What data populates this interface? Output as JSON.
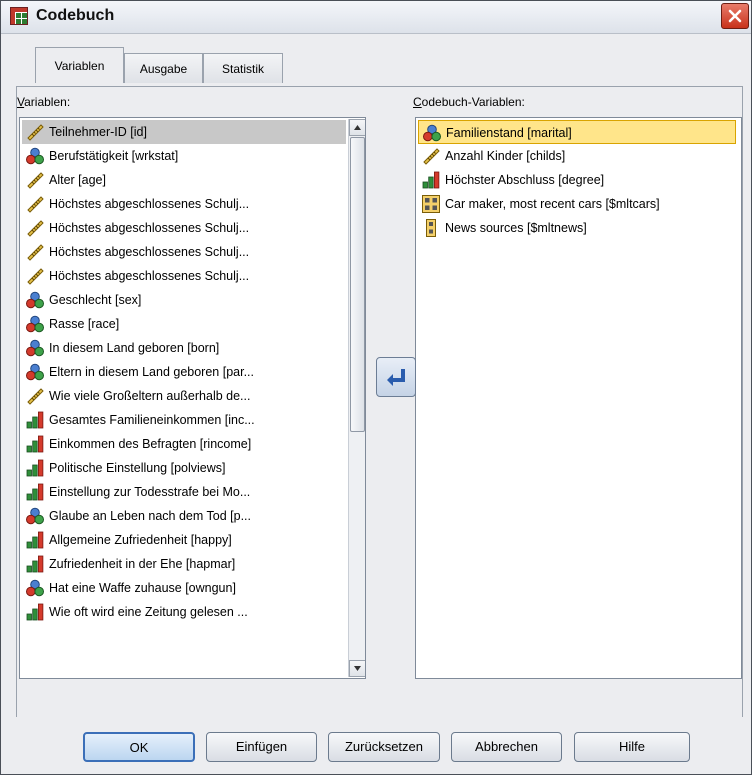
{
  "window": {
    "title": "Codebuch"
  },
  "tabs": [
    {
      "label": "Variablen",
      "active": true
    },
    {
      "label": "Ausgabe",
      "active": false
    },
    {
      "label": "Statistik",
      "active": false
    }
  ],
  "source_list": {
    "label_first": "V",
    "label_rest": "ariablen:",
    "items": [
      {
        "label": "Teilnehmer-ID [id]",
        "icon": "scale-icon",
        "selected": true
      },
      {
        "label": "Berufstätigkeit [wrkstat]",
        "icon": "nominal-icon"
      },
      {
        "label": "Alter [age]",
        "icon": "scale-icon"
      },
      {
        "label": "Höchstes abgeschlossenes Schulj...",
        "icon": "scale-icon"
      },
      {
        "label": "Höchstes abgeschlossenes Schulj...",
        "icon": "scale-icon"
      },
      {
        "label": "Höchstes abgeschlossenes Schulj...",
        "icon": "scale-icon"
      },
      {
        "label": "Höchstes abgeschlossenes Schulj...",
        "icon": "scale-icon"
      },
      {
        "label": "Geschlecht [sex]",
        "icon": "nominal-icon"
      },
      {
        "label": "Rasse [race]",
        "icon": "nominal-icon"
      },
      {
        "label": "In diesem Land geboren [born]",
        "icon": "nominal-icon"
      },
      {
        "label": "Eltern in diesem Land geboren [par...",
        "icon": "nominal-icon"
      },
      {
        "label": "Wie viele Großeltern außerhalb de...",
        "icon": "scale-icon"
      },
      {
        "label": "Gesamtes Familieneinkommen [inc...",
        "icon": "ordinal-icon"
      },
      {
        "label": "Einkommen des Befragten [rincome]",
        "icon": "ordinal-icon"
      },
      {
        "label": "Politische Einstellung [polviews]",
        "icon": "ordinal-icon"
      },
      {
        "label": "Einstellung zur Todesstrafe bei Mo...",
        "icon": "ordinal-icon"
      },
      {
        "label": "Glaube an Leben nach dem Tod [p...",
        "icon": "nominal-icon"
      },
      {
        "label": "Allgemeine Zufriedenheit [happy]",
        "icon": "ordinal-icon"
      },
      {
        "label": "Zufriedenheit in der Ehe [hapmar]",
        "icon": "ordinal-icon"
      },
      {
        "label": "Hat eine Waffe zuhause [owngun]",
        "icon": "nominal-icon"
      },
      {
        "label": "Wie oft wird eine Zeitung gelesen ...",
        "icon": "ordinal-icon"
      }
    ]
  },
  "target_list": {
    "label_first": "C",
    "label_rest": "odebuch-Variablen:",
    "items": [
      {
        "label": "Familienstand [marital]",
        "icon": "nominal-icon",
        "highlighted": true
      },
      {
        "label": "Anzahl Kinder [childs]",
        "icon": "scale-icon"
      },
      {
        "label": "Höchster Abschluss [degree]",
        "icon": "ordinal-icon"
      },
      {
        "label": "Car maker, most recent cars [$mltcars]",
        "icon": "multiple-response-set-icon"
      },
      {
        "label": "News sources [$mltnews]",
        "icon": "multiple-dichotomy-set-icon"
      }
    ]
  },
  "move_button": {
    "icon": "arrow-left-icon"
  },
  "buttons": [
    {
      "name": "ok-button",
      "label": "OK"
    },
    {
      "name": "paste-button",
      "label": "Einfügen"
    },
    {
      "name": "reset-button",
      "label": "Zurücksetzen"
    },
    {
      "name": "cancel-button",
      "label": "Abbrechen"
    },
    {
      "name": "help-button",
      "label": "Hilfe"
    }
  ],
  "colors": {
    "accent": "#3b6fb8",
    "highlight": "#ffe58a",
    "selection": "#c8c8c8"
  }
}
